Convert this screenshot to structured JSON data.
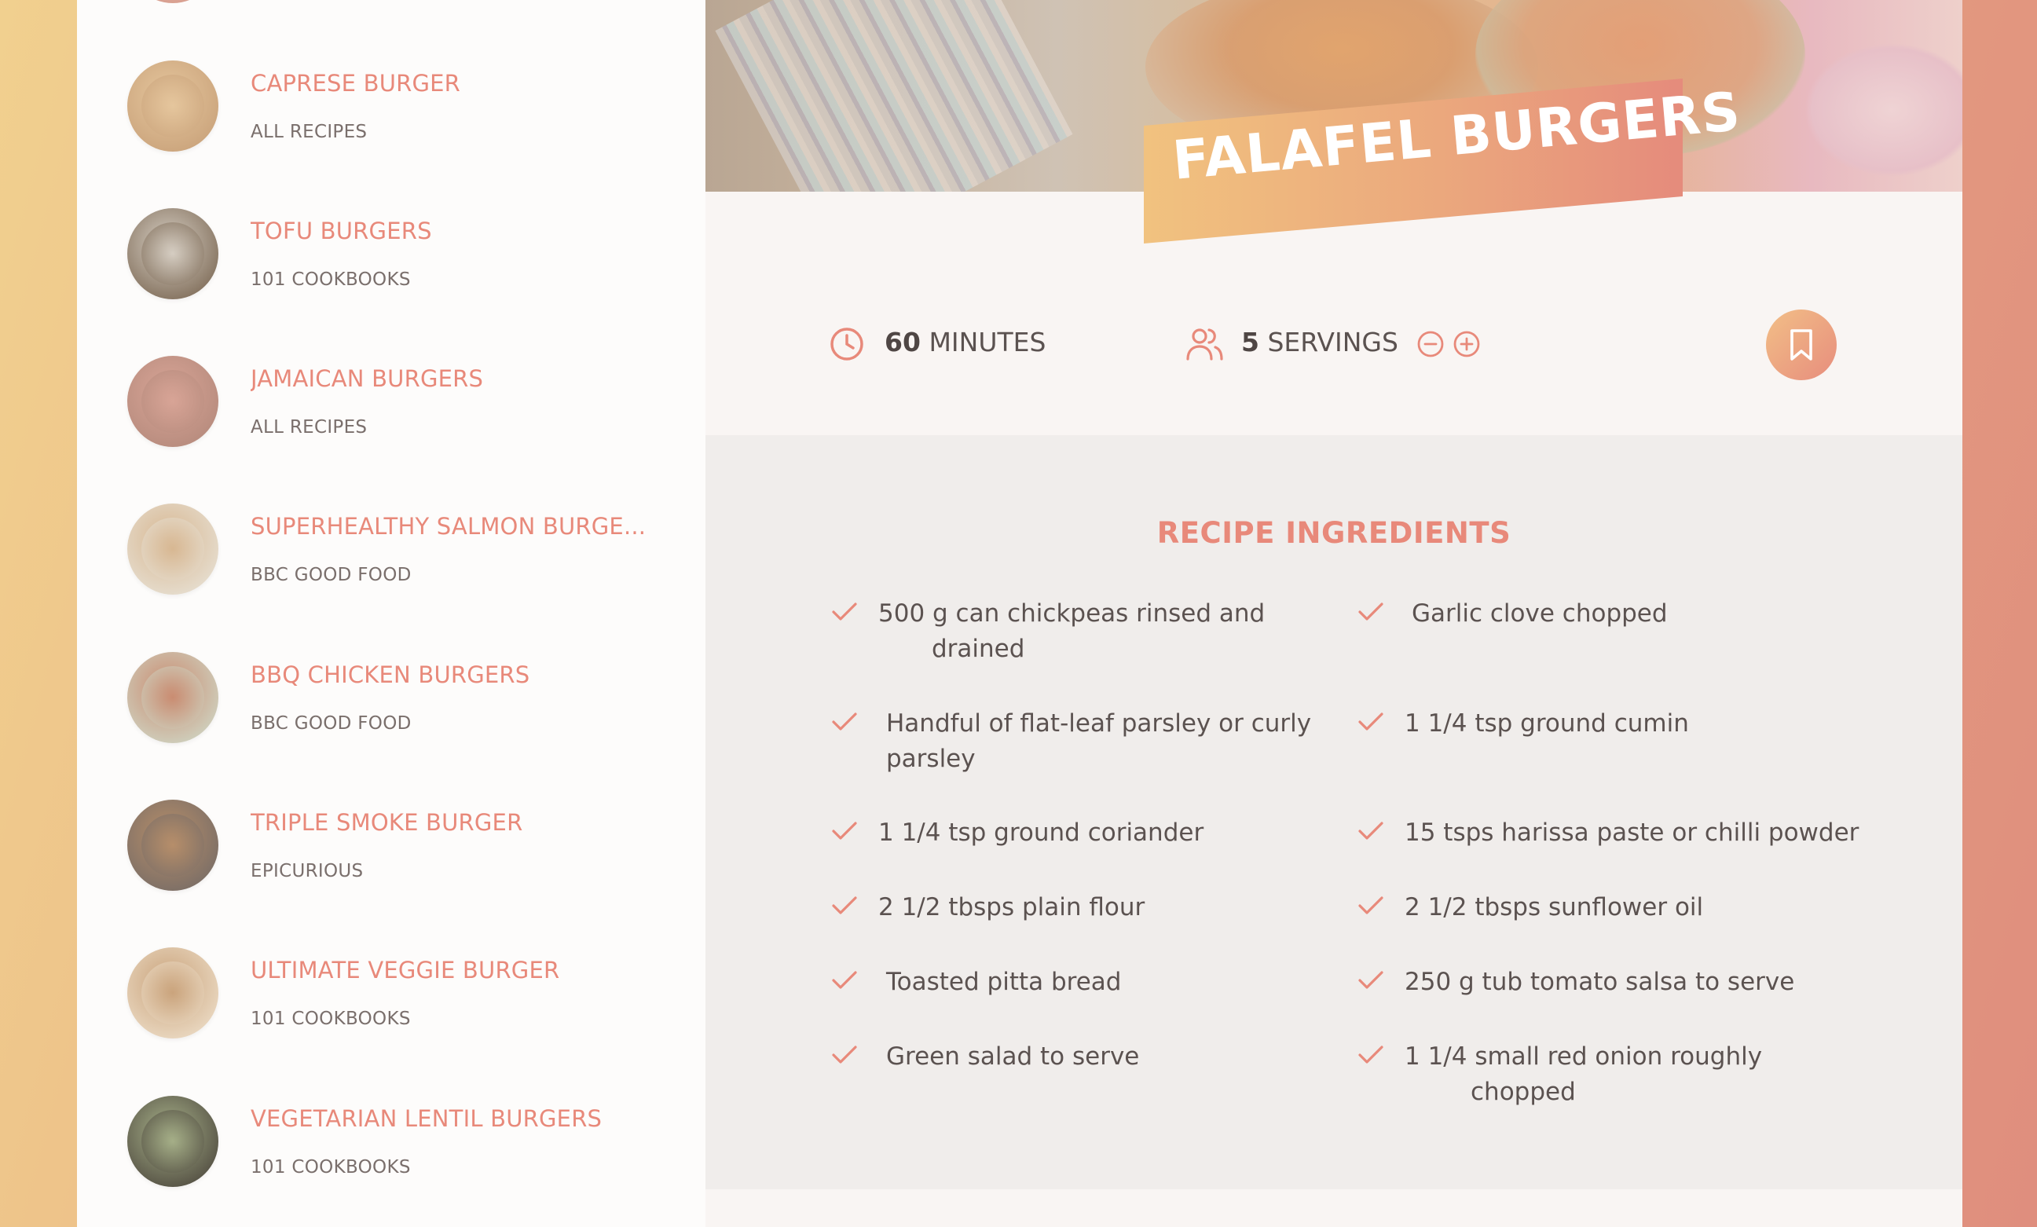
{
  "sidebar": {
    "results": [
      {
        "title": "CAPRESE BURGER",
        "publisher": "ALL RECIPES",
        "thumb": [
          "#c9a27a",
          "#e6c79e"
        ]
      },
      {
        "title": "TOFU BURGERS",
        "publisher": "101 COOKBOOKS",
        "thumb": [
          "#7d6a56",
          "#d8d0c5"
        ]
      },
      {
        "title": "JAMAICAN BURGERS",
        "publisher": "ALL RECIPES",
        "thumb": [
          "#b58a7c",
          "#d9a597"
        ]
      },
      {
        "title": "SUPERHEALTHY SALMON BURGE...",
        "publisher": "BBC GOOD FOOD",
        "thumb": [
          "#e7e0d3",
          "#d7b690"
        ]
      },
      {
        "title": "BBQ CHICKEN BURGERS",
        "publisher": "BBC GOOD FOOD",
        "thumb": [
          "#cfd5c3",
          "#c98a6f"
        ]
      },
      {
        "title": "TRIPLE SMOKE BURGER",
        "publisher": "EPICURIOUS",
        "thumb": [
          "#776c66",
          "#b88f6a"
        ]
      },
      {
        "title": "ULTIMATE VEGGIE BURGER",
        "publisher": "101 COOKBOOKS",
        "thumb": [
          "#ecdcc6",
          "#c9a27a"
        ]
      },
      {
        "title": "VEGETARIAN LENTIL BURGERS",
        "publisher": "101 COOKBOOKS",
        "thumb": [
          "#4f4a3f",
          "#a8b28a"
        ]
      }
    ]
  },
  "recipe": {
    "title": "FALAFEL BURGERS",
    "time": {
      "value": "60",
      "unit": "MINUTES",
      "icon": "clock-icon"
    },
    "servings": {
      "value": "5",
      "unit": "SERVINGS",
      "icon": "users-icon"
    },
    "decrease_icon": "minus-circle-icon",
    "increase_icon": "plus-circle-icon",
    "bookmark_icon": "bookmark-icon",
    "ingredients_heading": "RECIPE INGREDIENTS",
    "ingredients_left": [
      {
        "first": "500 g can chickpeas rinsed and",
        "second": "drained"
      },
      {
        "first": "Handful of flat-leaf parsley or curly",
        "second": "parsley"
      },
      {
        "first": "1 1/4 tsp ground coriander",
        "second": ""
      },
      {
        "first": "2 1/2 tbsps plain flour",
        "second": ""
      },
      {
        "first": "Toasted pitta bread",
        "second": ""
      },
      {
        "first": "Green salad to serve",
        "second": ""
      }
    ],
    "ingredients_right": [
      {
        "first": "Garlic clove chopped",
        "second": ""
      },
      {
        "first": "1 1/4 tsp ground cumin",
        "second": ""
      },
      {
        "first": "15 tsps harissa paste or chilli powder",
        "second": ""
      },
      {
        "first": "2 1/2 tbsps sunflower oil",
        "second": ""
      },
      {
        "first": "250 g tub tomato salsa to serve",
        "second": ""
      },
      {
        "first": "1 1/4 small red onion roughly",
        "second": "chopped"
      }
    ]
  },
  "colors": {
    "accent": "#e8897a",
    "text": "#5b5250",
    "panel": "#f9f5f3",
    "ingredients_bg": "#f0edeb"
  }
}
